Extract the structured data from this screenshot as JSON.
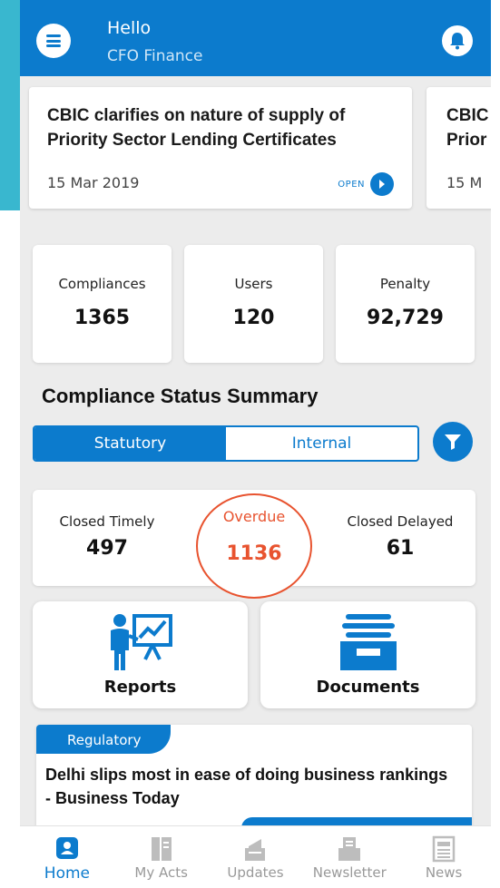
{
  "header": {
    "greeting": "Hello",
    "organization": "CFO Finance"
  },
  "news_carousel": [
    {
      "title": "CBIC clarifies on nature of supply of Priority Sector Lending Certificates",
      "date": "15 Mar 2019",
      "open_label": "OPEN"
    },
    {
      "title": "CBIC Prior",
      "date": "15 M",
      "open_label": ""
    }
  ],
  "stats": [
    {
      "label": "Compliances",
      "value": "1365"
    },
    {
      "label": "Users",
      "value": "120"
    },
    {
      "label": "Penalty",
      "value": "92,729"
    }
  ],
  "summary": {
    "title": "Compliance Status Summary",
    "tabs": [
      "Statutory",
      "Internal"
    ],
    "active_tab": "Statutory",
    "closed_timely_label": "Closed Timely",
    "closed_timely_value": "497",
    "overdue_label": "Overdue",
    "overdue_value": "1136",
    "closed_delayed_label": "Closed Delayed",
    "closed_delayed_value": "61"
  },
  "tiles": [
    {
      "label": "Reports",
      "icon": "reports-icon"
    },
    {
      "label": "Documents",
      "icon": "documents-icon"
    }
  ],
  "regulatory_news": {
    "tag": "Regulatory",
    "title": "Delhi slips most in ease of doing business rankings - Business Today"
  },
  "bottom_nav": [
    {
      "label": "Home",
      "icon": "home-icon",
      "active": true
    },
    {
      "label": "My Acts",
      "icon": "book-icon",
      "active": false
    },
    {
      "label": "Updates",
      "icon": "megaphone-icon",
      "active": false
    },
    {
      "label": "Newsletter",
      "icon": "newsletter-icon",
      "active": false
    },
    {
      "label": "News",
      "icon": "newspaper-icon",
      "active": false
    }
  ],
  "colors": {
    "primary": "#0c7bcd",
    "overdue": "#e8532f",
    "accent_strip": "#39b7cf"
  }
}
